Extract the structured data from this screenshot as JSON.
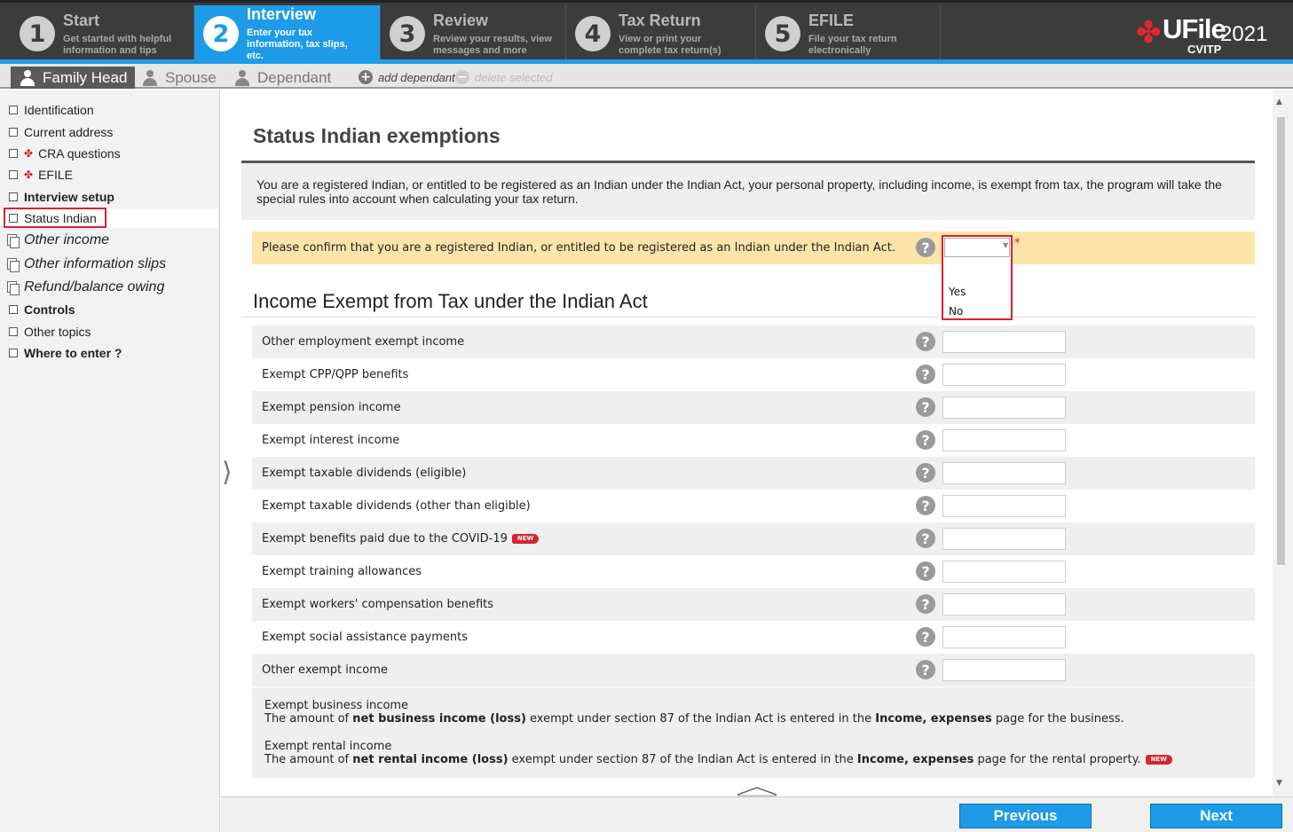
{
  "steps": [
    {
      "num": "1",
      "title": "Start",
      "sub": "Get started with helpful information and tips"
    },
    {
      "num": "2",
      "title": "Interview",
      "sub": "Enter your tax information, tax slips, etc."
    },
    {
      "num": "3",
      "title": "Review",
      "sub": "Review your results, view messages and more"
    },
    {
      "num": "4",
      "title": "Tax Return",
      "sub": "View or print your complete tax return(s)"
    },
    {
      "num": "5",
      "title": "EFILE",
      "sub": "File your tax return electronically"
    }
  ],
  "logo": {
    "name": "UFile",
    "year": "2021",
    "sub": "CVITP"
  },
  "tabs": {
    "family_head": "Family Head",
    "spouse": "Spouse",
    "dependant": "Dependant",
    "add": "add dependant",
    "delete": "delete selected"
  },
  "sidebar": [
    "Identification",
    "Current address",
    "CRA questions",
    "EFILE",
    "Interview setup",
    "Status Indian",
    "Other income",
    "Other information slips",
    "Refund/balance owing",
    "Controls",
    "Other topics",
    "Where to enter ?"
  ],
  "page": {
    "title": "Status Indian exemptions",
    "intro": "You are a registered Indian, or entitled to be registered as an Indian under the Indian Act, your personal property, including  income, is exempt from tax, the program will take the special rules into account when calculating your tax return.",
    "confirm": "Please confirm that you are a registered Indian, or entitled to be registered as an Indian under the Indian Act.",
    "required_mark": "*",
    "dropdown": {
      "value": "",
      "options": [
        "Yes",
        "No"
      ]
    },
    "section_title": "Income Exempt from Tax under the Indian Act",
    "rows": [
      "Other employment exempt income",
      "Exempt CPP/QPP benefits",
      "Exempt pension income",
      "Exempt interest income",
      "Exempt taxable dividends (eligible)",
      "Exempt taxable dividends (other than eligible)",
      "Exempt benefits paid due to the COVID-19",
      "Exempt training allowances",
      "Exempt workers' compensation benefits",
      "Exempt social assistance payments",
      "Other exempt income"
    ],
    "new_badge": "NEW",
    "notes": {
      "business_title": "Exempt business income",
      "business_pre": "The amount of ",
      "business_bold": "net business income (loss)",
      "business_mid": " exempt under section 87 of the Indian Act is entered in the ",
      "business_bold2": "Income, expenses",
      "business_post": " page for the business.",
      "rental_title": "Exempt rental income",
      "rental_pre": "The amount of ",
      "rental_bold": "net rental income (loss)",
      "rental_mid": " exempt under section 87 of the Indian Act is entered in the ",
      "rental_bold2": "Income, expenses",
      "rental_post": " page for the rental property."
    }
  },
  "footer": {
    "previous": "Previous",
    "next": "Next"
  },
  "colors": {
    "accent": "#1e9be8",
    "topbar": "#3c3c3c",
    "highlight": "#fde4a8",
    "alert": "#d9232e"
  }
}
